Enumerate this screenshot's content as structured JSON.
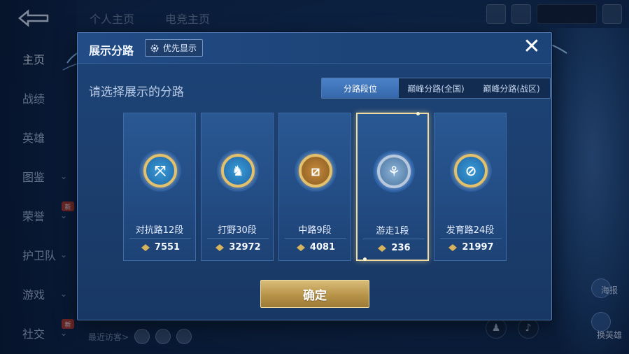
{
  "background": {
    "sidebar": [
      {
        "label": "主页",
        "active": true
      },
      {
        "label": "战绩"
      },
      {
        "label": "英雄"
      },
      {
        "label": "图鉴",
        "chevron": true
      },
      {
        "label": "荣誉",
        "chevron": true,
        "badge": "新"
      },
      {
        "label": "护卫队",
        "chevron": true
      },
      {
        "label": "游戏",
        "chevron": true
      },
      {
        "label": "社交",
        "chevron": true,
        "badge": "新"
      }
    ],
    "top_tabs": [
      "个人主页",
      "电竞主页"
    ],
    "recent_visitors_label": "最近访客>",
    "right_labels": [
      "海报",
      "换英雄"
    ]
  },
  "dialog": {
    "title": "展示分路",
    "priority_button": "优先显示",
    "close_symbol": "✕",
    "subtitle": "请选择展示的分路",
    "segments": [
      "分路段位",
      "巅峰分路(全国)",
      "巅峰分路(战区)"
    ],
    "active_segment": 0,
    "cards": [
      {
        "label": "对抗路12段",
        "score": "7551",
        "icon": "lane-clash-icon"
      },
      {
        "label": "打野30段",
        "score": "32972",
        "icon": "jungle-icon"
      },
      {
        "label": "中路9段",
        "score": "4081",
        "icon": "mid-lane-icon"
      },
      {
        "label": "游走1段",
        "score": "236",
        "icon": "roam-icon",
        "selected": true
      },
      {
        "label": "发育路24段",
        "score": "21997",
        "icon": "farm-lane-icon"
      }
    ],
    "confirm_button": "确定"
  },
  "colors": {
    "accent_gold": "#d8bd7a",
    "segment_active": "#4b82c8",
    "dialog_bg": "#1d4478"
  }
}
